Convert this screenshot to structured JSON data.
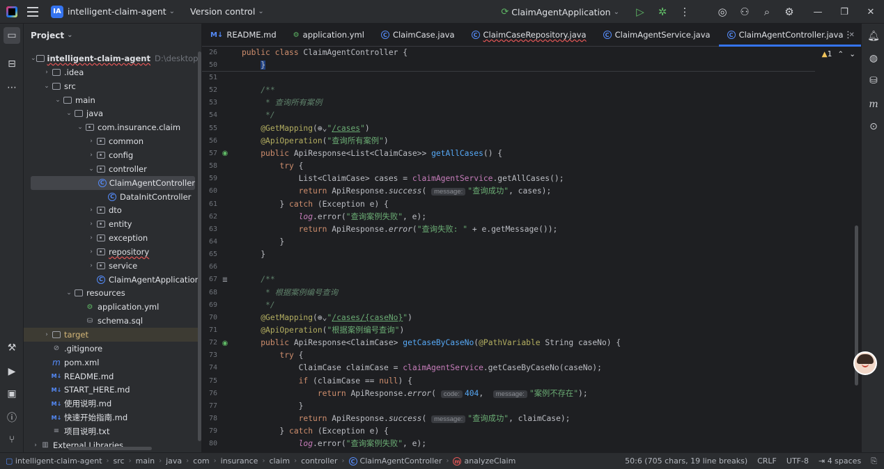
{
  "titlebar": {
    "project_badge": "IA",
    "project_name": "intelligent-claim-agent",
    "vcs": "Version control",
    "run_config": "ClaimAgentApplication"
  },
  "project_panel": {
    "title": "Project",
    "tree": [
      {
        "label": "intelligent-claim-agent",
        "extra": "D:\\desktop\\openga",
        "type": "folder",
        "indent": 0,
        "arrow": "v",
        "bold": true
      },
      {
        "label": ".idea",
        "type": "folder",
        "indent": 1,
        "arrow": ">"
      },
      {
        "label": "src",
        "type": "folder",
        "indent": 1,
        "arrow": "v"
      },
      {
        "label": "main",
        "type": "folder",
        "indent": 2,
        "arrow": "v"
      },
      {
        "label": "java",
        "type": "folder",
        "indent": 3,
        "arrow": "v"
      },
      {
        "label": "com.insurance.claim",
        "type": "pkg",
        "indent": 4,
        "arrow": "v"
      },
      {
        "label": "common",
        "type": "pkg",
        "indent": 5,
        "arrow": ">"
      },
      {
        "label": "config",
        "type": "pkg",
        "indent": 5,
        "arrow": ">"
      },
      {
        "label": "controller",
        "type": "pkg",
        "indent": 5,
        "arrow": "v"
      },
      {
        "label": "ClaimAgentController",
        "type": "class",
        "indent": 6,
        "arrow": "",
        "selected": true
      },
      {
        "label": "DataInitController",
        "type": "class",
        "indent": 6,
        "arrow": ""
      },
      {
        "label": "dto",
        "type": "pkg",
        "indent": 5,
        "arrow": ">"
      },
      {
        "label": "entity",
        "type": "pkg",
        "indent": 5,
        "arrow": ">"
      },
      {
        "label": "exception",
        "type": "pkg",
        "indent": 5,
        "arrow": ">"
      },
      {
        "label": "repository",
        "type": "pkg",
        "indent": 5,
        "arrow": ">",
        "redline": true
      },
      {
        "label": "service",
        "type": "pkg",
        "indent": 5,
        "arrow": ">"
      },
      {
        "label": "ClaimAgentApplication",
        "type": "class",
        "indent": 5,
        "arrow": ""
      },
      {
        "label": "resources",
        "type": "folder",
        "indent": 3,
        "arrow": "v"
      },
      {
        "label": "application.yml",
        "type": "yml",
        "indent": 4,
        "arrow": ""
      },
      {
        "label": "schema.sql",
        "type": "sql",
        "indent": 4,
        "arrow": ""
      },
      {
        "label": "target",
        "type": "folder",
        "indent": 1,
        "arrow": ">",
        "highlight": true
      },
      {
        "label": ".gitignore",
        "type": "git",
        "indent": 1,
        "arrow": ""
      },
      {
        "label": "pom.xml",
        "type": "maven",
        "indent": 1,
        "arrow": ""
      },
      {
        "label": "README.md",
        "type": "md",
        "indent": 1,
        "arrow": ""
      },
      {
        "label": "START_HERE.md",
        "type": "md",
        "indent": 1,
        "arrow": ""
      },
      {
        "label": "使用说明.md",
        "type": "md",
        "indent": 1,
        "arrow": ""
      },
      {
        "label": "快速开始指南.md",
        "type": "md",
        "indent": 1,
        "arrow": ""
      },
      {
        "label": "项目说明.txt",
        "type": "txt",
        "indent": 1,
        "arrow": ""
      },
      {
        "label": "External Libraries",
        "type": "lib",
        "indent": 0,
        "arrow": ">"
      }
    ]
  },
  "tabs": [
    {
      "label": "README.md",
      "icon": "M↓"
    },
    {
      "label": "application.yml",
      "icon": "yml"
    },
    {
      "label": "ClaimCase.java",
      "icon": "C"
    },
    {
      "label": "ClaimCaseRepository.java",
      "icon": "C",
      "redline": true
    },
    {
      "label": "ClaimAgentService.java",
      "icon": "C"
    },
    {
      "label": "ClaimAgentController.java",
      "icon": "C",
      "active": true
    }
  ],
  "editor": {
    "warnings": "1",
    "sticky_lines": [
      {
        "n": "26",
        "html": "<span class='kw'>public class</span> ClaimAgentController {"
      },
      {
        "n": "50",
        "html": "    <span class='selbox'>}</span>"
      }
    ],
    "lines": [
      {
        "n": "51",
        "html": ""
      },
      {
        "n": "52",
        "html": "    <span class='cm'>/**</span>"
      },
      {
        "n": "53",
        "html": "<span class='cm'>     * 查询所有案例</span>"
      },
      {
        "n": "54",
        "html": "<span class='cm'>     */</span>"
      },
      {
        "n": "55",
        "html": "    <span class='an'>@GetMapping</span>(⊕⌄<span class='str'>\"<u>/cases</u>\"</span>)"
      },
      {
        "n": "56",
        "html": "    <span class='an'>@ApiOperation</span>(<span class='str'>\"查询所有案例\"</span>)"
      },
      {
        "n": "57",
        "html": "    <span class='kw'>public</span> ApiResponse&lt;List&lt;ClaimCase&gt;&gt; <span class='fn'>getAllCases</span>() {",
        "mark": "run"
      },
      {
        "n": "58",
        "html": "        <span class='kw'>try</span> {"
      },
      {
        "n": "59",
        "html": "            List&lt;ClaimCase&gt; cases = <span class='fld'>claimAgentService</span>.getAllCases();"
      },
      {
        "n": "60",
        "html": "            <span class='kw'>return</span> ApiResponse.<span class='it'>success</span>( <span class='hint'>message:</span><span class='str'>\"查询成功\"</span>, cases);"
      },
      {
        "n": "61",
        "html": "        } <span class='kw'>catch</span> (Exception e) {"
      },
      {
        "n": "62",
        "html": "            <span class='fld it'>log</span>.error(<span class='str'>\"查询案例失败\"</span>, e);"
      },
      {
        "n": "63",
        "html": "            <span class='kw'>return</span> ApiResponse.<span class='it'>error</span>(<span class='str'>\"查询失败: \"</span> + e.getMessage());"
      },
      {
        "n": "64",
        "html": "        }"
      },
      {
        "n": "65",
        "html": "    }"
      },
      {
        "n": "66",
        "html": ""
      },
      {
        "n": "67",
        "html": "    <span class='cm'>/**</span>",
        "mark": "doc"
      },
      {
        "n": "68",
        "html": "<span class='cm'>     * 根据案例编号查询</span>"
      },
      {
        "n": "69",
        "html": "<span class='cm'>     */</span>"
      },
      {
        "n": "70",
        "html": "    <span class='an'>@GetMapping</span>(⊕⌄<span class='str'>\"<u>/cases/{caseNo}</u>\"</span>)"
      },
      {
        "n": "71",
        "html": "    <span class='an'>@ApiOperation</span>(<span class='str'>\"根据案例编号查询\"</span>)"
      },
      {
        "n": "72",
        "html": "    <span class='kw'>public</span> ApiResponse&lt;ClaimCase&gt; <span class='fn'>getCaseByCaseNo</span>(<span class='an'>@PathVariable</span> String caseNo) {",
        "mark": "run"
      },
      {
        "n": "73",
        "html": "        <span class='kw'>try</span> {"
      },
      {
        "n": "74",
        "html": "            ClaimCase claimCase = <span class='fld'>claimAgentService</span>.getCaseByCaseNo(caseNo);"
      },
      {
        "n": "75",
        "html": "            <span class='kw'>if</span> (claimCase == <span class='kw'>null</span>) {"
      },
      {
        "n": "76",
        "html": "                <span class='kw'>return</span> ApiResponse.<span class='it'>error</span>( <span class='hint'>code:</span><span class='fn'>404</span>,  <span class='hint'>message:</span><span class='str'>\"案例不存在\"</span>);"
      },
      {
        "n": "77",
        "html": "            }"
      },
      {
        "n": "78",
        "html": "            <span class='kw'>return</span> ApiResponse.<span class='it'>success</span>( <span class='hint'>message:</span><span class='str'>\"查询成功\"</span>, claimCase);"
      },
      {
        "n": "79",
        "html": "        } <span class='kw'>catch</span> (Exception e) {"
      },
      {
        "n": "80",
        "html": "            <span class='fld it'>log</span>.error(<span class='str'>\"查询案例失败\"</span>, e);"
      }
    ]
  },
  "statusbar": {
    "breadcrumb": [
      "intelligent-claim-agent",
      "src",
      "main",
      "java",
      "com",
      "insurance",
      "claim",
      "controller",
      "ClaimAgentController",
      "analyzeClaim"
    ],
    "position": "50:6 (705 chars, 19 line breaks)",
    "line_sep": "CRLF",
    "encoding": "UTF-8",
    "indent": "4 spaces"
  }
}
